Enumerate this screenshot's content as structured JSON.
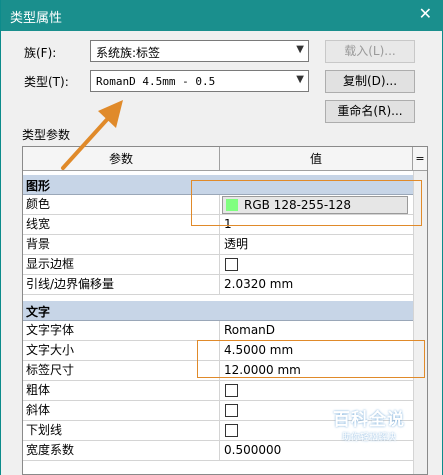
{
  "window": {
    "title": "类型属性",
    "close": "✕"
  },
  "family": {
    "label": "族(F):",
    "value": "系统族:标签"
  },
  "type": {
    "label": "类型(T):",
    "value": "RomanD 4.5mm - 0.5"
  },
  "buttons": {
    "load": "载入(L)...",
    "duplicate": "复制(D)...",
    "rename": "重命名(R)..."
  },
  "type_params_label": "类型参数",
  "table": {
    "headers": {
      "param": "参数",
      "value": "值",
      "extra": "="
    },
    "groups": [
      {
        "name": "图形",
        "collapse": "⌃",
        "rows": [
          {
            "name": "颜色",
            "value": "RGB 128-255-128"
          },
          {
            "name": "线宽",
            "value": "1"
          },
          {
            "name": "背景",
            "value": "透明"
          },
          {
            "name": "显示边框",
            "value": ""
          },
          {
            "name": "引线/边界偏移量",
            "value": "2.0320 mm"
          }
        ]
      },
      {
        "name": "文字",
        "collapse": "⌃",
        "rows": [
          {
            "name": "文字字体",
            "value": "RomanD"
          },
          {
            "name": "文字大小",
            "value": "4.5000 mm"
          },
          {
            "name": "标签尺寸",
            "value": "12.0000 mm"
          },
          {
            "name": "粗体",
            "value": ""
          },
          {
            "name": "斜体",
            "value": ""
          },
          {
            "name": "下划线",
            "value": ""
          },
          {
            "name": "宽度系数",
            "value": "0.500000"
          }
        ]
      }
    ]
  },
  "colors": {
    "swatch": "#80ff80",
    "highlight": "#e08a2a",
    "titlebar": "#1a8f8d"
  },
  "watermark": {
    "title": "百科全说",
    "subtitle": "助你轻松解决"
  }
}
